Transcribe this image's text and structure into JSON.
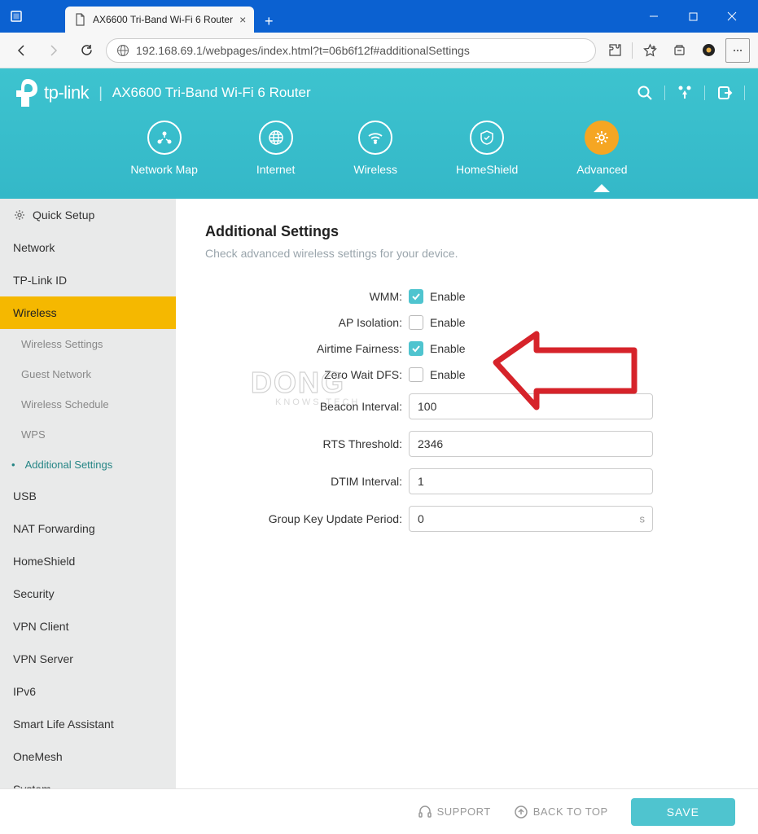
{
  "browser": {
    "tab_title": "AX6600 Tri-Band Wi-Fi 6 Router",
    "url": "192.168.69.1/webpages/index.html?t=06b6f12f#additionalSettings"
  },
  "header": {
    "logo": "tp-link",
    "product": "AX6600 Tri-Band Wi-Fi 6 Router",
    "nav": [
      {
        "label": "Network Map",
        "icon": "network-map",
        "active": false
      },
      {
        "label": "Internet",
        "icon": "globe",
        "active": false
      },
      {
        "label": "Wireless",
        "icon": "wifi",
        "active": false
      },
      {
        "label": "HomeShield",
        "icon": "shield",
        "active": false
      },
      {
        "label": "Advanced",
        "icon": "gear",
        "active": true
      }
    ]
  },
  "sidebar": {
    "items": [
      {
        "label": "Quick Setup",
        "type": "item",
        "icon": "gear"
      },
      {
        "label": "Network",
        "type": "item"
      },
      {
        "label": "TP-Link ID",
        "type": "item"
      },
      {
        "label": "Wireless",
        "type": "item",
        "active": true
      },
      {
        "label": "Wireless Settings",
        "type": "sub"
      },
      {
        "label": "Guest Network",
        "type": "sub"
      },
      {
        "label": "Wireless Schedule",
        "type": "sub"
      },
      {
        "label": "WPS",
        "type": "sub"
      },
      {
        "label": "Additional Settings",
        "type": "sub",
        "active": true
      },
      {
        "label": "USB",
        "type": "item"
      },
      {
        "label": "NAT Forwarding",
        "type": "item"
      },
      {
        "label": "HomeShield",
        "type": "item"
      },
      {
        "label": "Security",
        "type": "item"
      },
      {
        "label": "VPN Client",
        "type": "item"
      },
      {
        "label": "VPN Server",
        "type": "item"
      },
      {
        "label": "IPv6",
        "type": "item"
      },
      {
        "label": "Smart Life Assistant",
        "type": "item"
      },
      {
        "label": "OneMesh",
        "type": "item"
      },
      {
        "label": "System",
        "type": "item"
      }
    ]
  },
  "page": {
    "title": "Additional Settings",
    "subtitle": "Check advanced wireless settings for your device.",
    "enable_label": "Enable",
    "fields": {
      "wmm": {
        "label": "WMM:",
        "checked": true
      },
      "ap_isolation": {
        "label": "AP Isolation:",
        "checked": false
      },
      "airtime_fairness": {
        "label": "Airtime Fairness:",
        "checked": true
      },
      "zero_wait_dfs": {
        "label": "Zero Wait DFS:",
        "checked": false
      },
      "beacon_interval": {
        "label": "Beacon Interval:",
        "value": "100"
      },
      "rts_threshold": {
        "label": "RTS Threshold:",
        "value": "2346"
      },
      "dtim_interval": {
        "label": "DTIM Interval:",
        "value": "1"
      },
      "group_key": {
        "label": "Group Key Update Period:",
        "value": "0",
        "suffix": "s"
      }
    }
  },
  "footer": {
    "support": "SUPPORT",
    "back_to_top": "BACK TO TOP",
    "save": "SAVE"
  },
  "watermark": "DONG"
}
